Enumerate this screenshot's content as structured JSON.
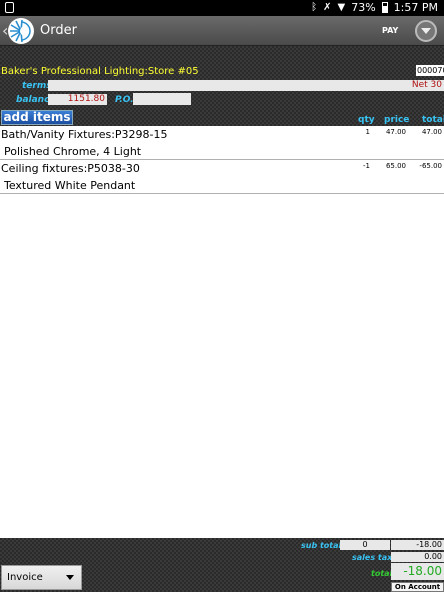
{
  "status_bar": {
    "battery": "73%",
    "time": "1:57 PM",
    "icons": [
      "notification-icon",
      "bluetooth-icon",
      "mute-icon",
      "wifi-icon",
      "battery-icon"
    ]
  },
  "action_bar": {
    "title": "Order",
    "pay_label": "PAY"
  },
  "order": {
    "customer": "Baker's Professional Lighting:Store #05",
    "order_number": "000070",
    "terms_label": "terms",
    "terms_value": "Net 30",
    "balance_label": "balance",
    "balance_value": "1151.80",
    "po_label": "P.O.",
    "po_value": "",
    "add_items_label": "add items",
    "columns": {
      "qty": "qty",
      "price": "price",
      "total": "total"
    }
  },
  "items": [
    {
      "name": "Bath/Vanity Fixtures:P3298-15",
      "description": "Polished Chrome, 4 Light",
      "qty": "1",
      "price": "47.00",
      "total": "47.00"
    },
    {
      "name": "Ceiling fixtures:P5038-30",
      "description": "Textured White Pendant",
      "qty": "-1",
      "price": "65.00",
      "total": "-65.00"
    }
  ],
  "footer": {
    "doc_type": "Invoice",
    "subtotal_label": "sub total",
    "subtotal_qty": "0",
    "subtotal_value": "-18.00",
    "tax_label": "sales tax",
    "tax_value": "0.00",
    "total_label": "total",
    "total_value": "-18.00",
    "payment_label": "On Account"
  },
  "colors": {
    "label_cyan": "#39c3f3",
    "customer_yellow": "#ffff33",
    "value_red": "#b01010",
    "total_green": "#22aa22",
    "button_blue": "#1c4ea0"
  }
}
